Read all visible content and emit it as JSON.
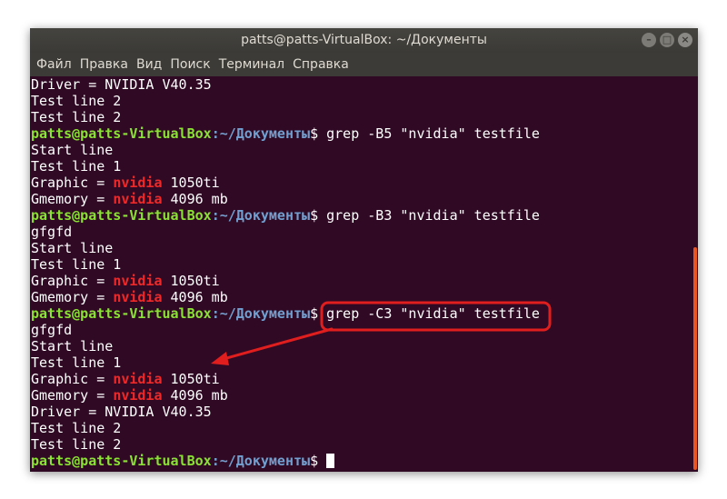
{
  "window": {
    "title": "patts@patts-VirtualBox: ~/Документы",
    "controls": {
      "minimize": "–",
      "maximize": "□",
      "close": "×"
    }
  },
  "menu": [
    "Файл",
    "Правка",
    "Вид",
    "Поиск",
    "Терминал",
    "Справка"
  ],
  "prompt": {
    "user": "patts@patts-VirtualBox",
    "path": ":~/Документы",
    "sign": "$ "
  },
  "lines": [
    {
      "text": "Driver = NVIDIA V40.35"
    },
    {
      "text": "Test line 2"
    },
    {
      "text": "Test line 2"
    },
    {
      "cmd": "grep -B5 \"nvidia\" testfile"
    },
    {
      "text": "Start line"
    },
    {
      "text": "Test line 1"
    },
    {
      "pre": "Graphic = ",
      "match": "nvidia",
      "post": " 1050ti"
    },
    {
      "pre": "Gmemory = ",
      "match": "nvidia",
      "post": " 4096 mb"
    },
    {
      "cmd": "grep -B3 \"nvidia\" testfile"
    },
    {
      "text": "gfgfd"
    },
    {
      "text": "Start line"
    },
    {
      "text": "Test line 1"
    },
    {
      "pre": "Graphic = ",
      "match": "nvidia",
      "post": " 1050ti"
    },
    {
      "pre": "Gmemory = ",
      "match": "nvidia",
      "post": " 4096 mb"
    },
    {
      "cmd": "grep -C3 \"nvidia\" testfile"
    },
    {
      "text": "gfgfd"
    },
    {
      "text": "Start line"
    },
    {
      "text": "Test line 1"
    },
    {
      "pre": "Graphic = ",
      "match": "nvidia",
      "post": " 1050ti"
    },
    {
      "pre": "Gmemory = ",
      "match": "nvidia",
      "post": " 4096 mb"
    },
    {
      "text": "Driver = NVIDIA V40.35"
    },
    {
      "text": "Test line 2"
    },
    {
      "text": "Test line 2"
    },
    {
      "cmd": "",
      "cursor": true
    }
  ],
  "colors": {
    "terminal_bg": "#300a24",
    "prompt_user": "#8ae234",
    "prompt_path": "#729fcf",
    "match": "#ef2929",
    "annotation": "#e01e1e"
  }
}
